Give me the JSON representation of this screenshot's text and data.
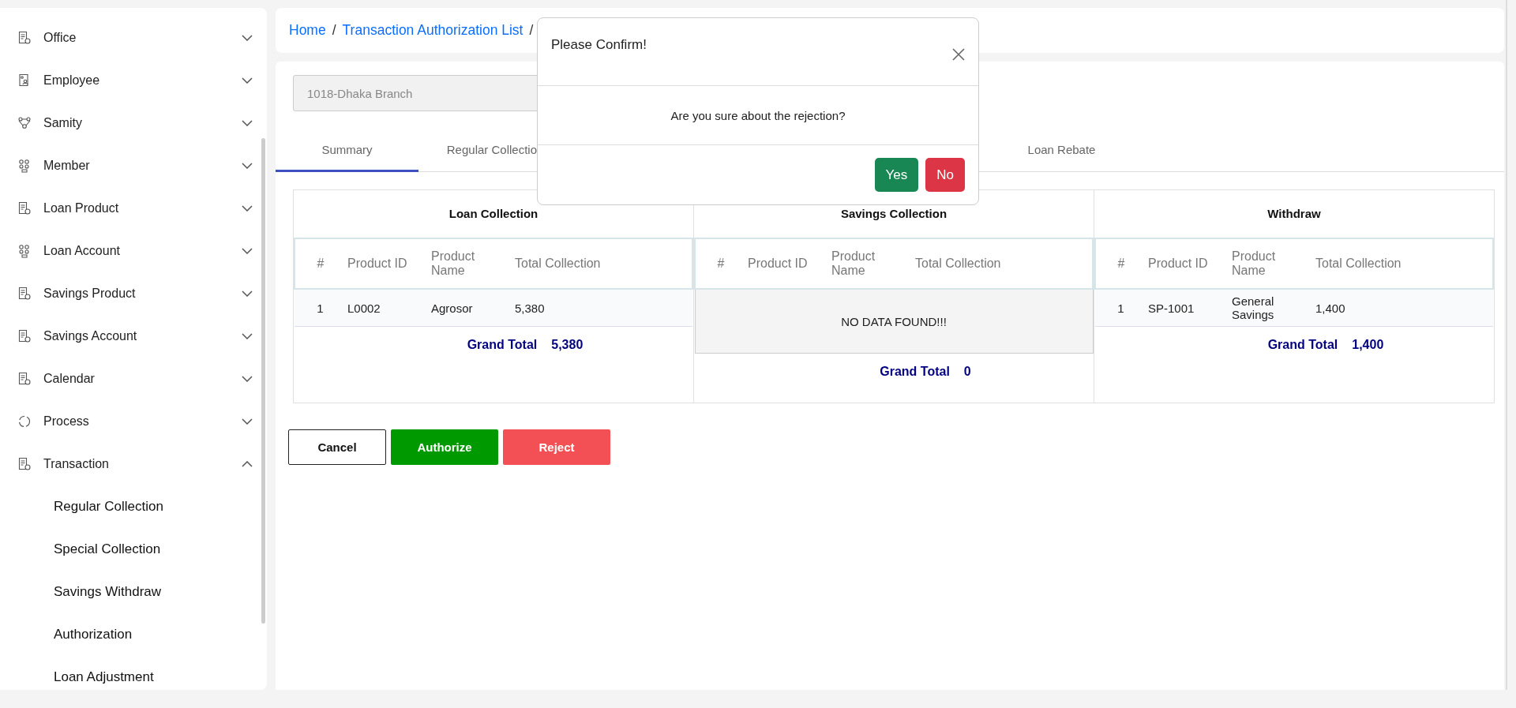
{
  "sidebar": {
    "items": [
      {
        "label": "Office",
        "expanded": false
      },
      {
        "label": "Employee",
        "expanded": false
      },
      {
        "label": "Samity",
        "expanded": false
      },
      {
        "label": "Member",
        "expanded": false
      },
      {
        "label": "Loan Product",
        "expanded": false
      },
      {
        "label": "Loan Account",
        "expanded": false
      },
      {
        "label": "Savings Product",
        "expanded": false
      },
      {
        "label": "Savings Account",
        "expanded": false
      },
      {
        "label": "Calendar",
        "expanded": false
      },
      {
        "label": "Process",
        "expanded": false
      },
      {
        "label": "Transaction",
        "expanded": true,
        "children": [
          {
            "label": "Regular Collection"
          },
          {
            "label": "Special Collection"
          },
          {
            "label": "Savings Withdraw"
          },
          {
            "label": "Authorization"
          },
          {
            "label": "Loan Adjustment"
          }
        ]
      }
    ]
  },
  "breadcrumb": [
    {
      "label": "Home",
      "separator": "/"
    },
    {
      "label": "Transaction Authorization List",
      "separator": "/"
    }
  ],
  "branch_field": {
    "value": "1018-Dhaka Branch"
  },
  "tabs": [
    {
      "label": "Summary",
      "selected": true
    },
    {
      "label": "Regular Collectio",
      "selected": false
    },
    {
      "label": "Loan Rebate",
      "selected": false
    }
  ],
  "sections": [
    {
      "title": "Loan Collection",
      "columns": [
        "#",
        "Product ID",
        "Product Name",
        "Total Collection"
      ],
      "rows": [
        [
          "1",
          "L0002",
          "Agrosor",
          "5,380"
        ]
      ],
      "grand_total_label": "Grand Total",
      "grand_total": "5,380"
    },
    {
      "title": "Savings Collection",
      "columns": [
        "#",
        "Product ID",
        "Product Name",
        "Total Collection"
      ],
      "empty_text": "NO DATA FOUND!!!",
      "grand_total_label": "Grand Total",
      "grand_total": "0"
    },
    {
      "title": "Withdraw",
      "columns": [
        "#",
        "Product ID",
        "Product Name",
        "Total Collection"
      ],
      "rows": [
        [
          "1",
          "SP-1001",
          "General Savings",
          "1,400"
        ]
      ],
      "grand_total_label": "Grand Total",
      "grand_total": "1,400"
    }
  ],
  "actions": [
    {
      "label": "Cancel",
      "kind": "outline"
    },
    {
      "label": "Authorize",
      "kind": "success"
    },
    {
      "label": "Reject",
      "kind": "danger"
    }
  ],
  "dialog": {
    "title": "Please Confirm!",
    "message": "Are you sure about the rejection?",
    "buttons": [
      {
        "label": "Yes",
        "kind": "confirm"
      },
      {
        "label": "No",
        "kind": "deny"
      }
    ]
  }
}
